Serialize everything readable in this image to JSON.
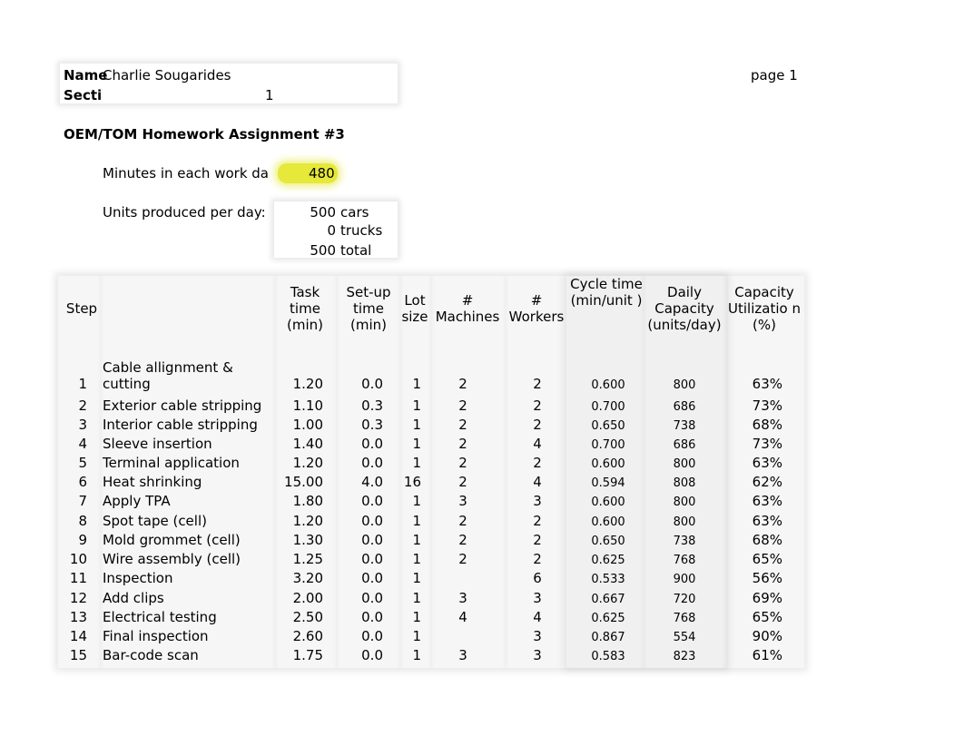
{
  "header": {
    "name_label": "Name",
    "name_value": "Charlie Sougarides",
    "section_label": "Secti",
    "section_value": "1",
    "page_label": "page 1",
    "title": "OEM/TOM Homework Assignment #3"
  },
  "inputs": {
    "minutes_label": "Minutes in each work da",
    "minutes_value": "480",
    "highlight_color": "#e6e83a",
    "units_label": "Units produced per day:",
    "units": [
      {
        "value": "500",
        "label": "cars"
      },
      {
        "value": "0",
        "label": "trucks"
      },
      {
        "value": "500",
        "label": "total"
      }
    ]
  },
  "table": {
    "headers": {
      "step": "Step",
      "task": "Task time (min)",
      "setup": "Set-up time (min)",
      "lot": "Lot size",
      "machines": "# Machines",
      "workers": "# Workers",
      "cycle": "Cycle time (min/unit )",
      "capacity": "Daily Capacity (units/day)",
      "utilization": "Capacity Utilizatio n (%)"
    },
    "rows": [
      {
        "step": "1",
        "desc": "Cable allignment & cutting",
        "task": "1.20",
        "setup": "0.0",
        "lot": "1",
        "machines": "2",
        "workers": "2",
        "cycle": "0.600",
        "capacity": "800",
        "util": "63%"
      },
      {
        "step": "2",
        "desc": "Exterior cable stripping",
        "task": "1.10",
        "setup": "0.3",
        "lot": "1",
        "machines": "2",
        "workers": "2",
        "cycle": "0.700",
        "capacity": "686",
        "util": "73%"
      },
      {
        "step": "3",
        "desc": "Interior cable stripping",
        "task": "1.00",
        "setup": "0.3",
        "lot": "1",
        "machines": "2",
        "workers": "2",
        "cycle": "0.650",
        "capacity": "738",
        "util": "68%"
      },
      {
        "step": "4",
        "desc": "Sleeve insertion",
        "task": "1.40",
        "setup": "0.0",
        "lot": "1",
        "machines": "2",
        "workers": "4",
        "cycle": "0.700",
        "capacity": "686",
        "util": "73%"
      },
      {
        "step": "5",
        "desc": "Terminal application",
        "task": "1.20",
        "setup": "0.0",
        "lot": "1",
        "machines": "2",
        "workers": "2",
        "cycle": "0.600",
        "capacity": "800",
        "util": "63%"
      },
      {
        "step": "6",
        "desc": "Heat shrinking",
        "task": "15.00",
        "setup": "4.0",
        "lot": "16",
        "machines": "2",
        "workers": "4",
        "cycle": "0.594",
        "capacity": "808",
        "util": "62%"
      },
      {
        "step": "7",
        "desc": "Apply TPA",
        "task": "1.80",
        "setup": "0.0",
        "lot": "1",
        "machines": "3",
        "workers": "3",
        "cycle": "0.600",
        "capacity": "800",
        "util": "63%"
      },
      {
        "step": "8",
        "desc": "Spot tape (cell)",
        "task": "1.20",
        "setup": "0.0",
        "lot": "1",
        "machines": "2",
        "workers": "2",
        "cycle": "0.600",
        "capacity": "800",
        "util": "63%"
      },
      {
        "step": "9",
        "desc": "Mold grommet (cell)",
        "task": "1.30",
        "setup": "0.0",
        "lot": "1",
        "machines": "2",
        "workers": "2",
        "cycle": "0.650",
        "capacity": "738",
        "util": "68%"
      },
      {
        "step": "10",
        "desc": "Wire assembly (cell)",
        "task": "1.25",
        "setup": "0.0",
        "lot": "1",
        "machines": "2",
        "workers": "2",
        "cycle": "0.625",
        "capacity": "768",
        "util": "65%"
      },
      {
        "step": "11",
        "desc": "Inspection",
        "task": "3.20",
        "setup": "0.0",
        "lot": "1",
        "machines": "",
        "workers": "6",
        "cycle": "0.533",
        "capacity": "900",
        "util": "56%"
      },
      {
        "step": "12",
        "desc": "Add clips",
        "task": "2.00",
        "setup": "0.0",
        "lot": "1",
        "machines": "3",
        "workers": "3",
        "cycle": "0.667",
        "capacity": "720",
        "util": "69%"
      },
      {
        "step": "13",
        "desc": "Electrical testing",
        "task": "2.50",
        "setup": "0.0",
        "lot": "1",
        "machines": "4",
        "workers": "4",
        "cycle": "0.625",
        "capacity": "768",
        "util": "65%"
      },
      {
        "step": "14",
        "desc": "Final inspection",
        "task": "2.60",
        "setup": "0.0",
        "lot": "1",
        "machines": "",
        "workers": "3",
        "cycle": "0.867",
        "capacity": "554",
        "util": "90%"
      },
      {
        "step": "15",
        "desc": "Bar-code scan",
        "task": "1.75",
        "setup": "0.0",
        "lot": "1",
        "machines": "3",
        "workers": "3",
        "cycle": "0.583",
        "capacity": "823",
        "util": "61%"
      }
    ]
  }
}
